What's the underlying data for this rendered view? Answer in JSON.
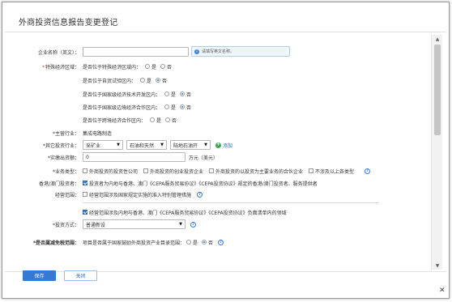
{
  "dialog": {
    "title": "外商投资信息报告变更登记"
  },
  "company_name": {
    "label": "企业名称（英文）：",
    "value": "",
    "hint": "请填写英文名称。"
  },
  "special_zone": {
    "label": "*特殊经济区域：",
    "items": [
      {
        "question": "是否位于特殊经济区域内：",
        "yes": "是",
        "no": "否",
        "selected": "none"
      },
      {
        "question": "是否位于自贸试验区内：",
        "yes": "是",
        "no": "否",
        "selected": "no"
      },
      {
        "question": "是否位于国家级经济技术开发区内：",
        "yes": "是",
        "no": "否",
        "selected": "no"
      },
      {
        "question": "是否位于国家级边境经济合作区内：",
        "yes": "是",
        "no": "否",
        "selected": "no"
      },
      {
        "question": "是否位于跨境经济合作区内：",
        "yes": "是",
        "no": "否",
        "selected": "none"
      }
    ]
  },
  "main_industry": {
    "label": "*主营行业：",
    "value": "集成电路制造"
  },
  "other_industry": {
    "label": "*其它投资行业：",
    "select1": "采矿业",
    "select2": "石油和天然",
    "select3": "陆地石油开",
    "add_label": "添加"
  },
  "paid_capital": {
    "label": "*实缴出资额：",
    "value": "0",
    "unit": "万元（美元）"
  },
  "business_type": {
    "label": "*业务类型：",
    "options": [
      "外商投资的投资性公司",
      "外商投资的创业投资企业",
      "外商投资的以投资为主要业务的合伙企业",
      "不涉及以上各类型"
    ],
    "help": "?"
  },
  "hk_macau": {
    "label": "香港/澳门投资者：",
    "text": "投资者为内地与香港、澳门《CEPA服务贸易协议》《CEPA投资协议》规定的香港/澳门投资者、服务提供者"
  },
  "scope": {
    "label": "经营范围：",
    "option1": "经营范围涉及国家规定实施的准入特别管理措施",
    "option2": "经营范围涉及内地与香港、澳门《CEPA服务贸易协议》《CEPA投资协议》负面清单内的领域"
  },
  "invest_method": {
    "label": "*投资方式：",
    "value": "普通新设"
  },
  "tax_exempt": {
    "label": "*是否属减免税范围：",
    "question": "项目是否属于国家鼓励外商投资产业目录范围：",
    "yes": "是",
    "no": "否",
    "selected": "no"
  },
  "footer": {
    "save": "保存",
    "close": "关闭"
  },
  "colors": {
    "primary": "#3579d3",
    "required": "#e0322c",
    "add_green": "#3aa757"
  }
}
